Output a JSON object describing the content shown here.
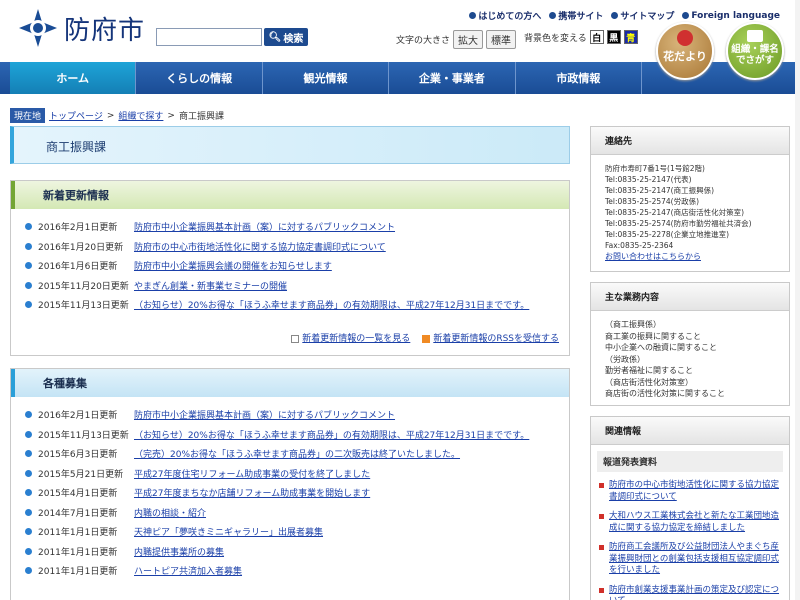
{
  "header": {
    "logo_text": "防府市",
    "search_button": "検索",
    "top_links": [
      "はじめての方へ",
      "携帯サイト",
      "サイトマップ",
      "Foreign language"
    ],
    "font_size_label": "文字の大きさ",
    "font_size_options": [
      "拡大",
      "標準"
    ],
    "bg_color_label": "背景色を変える",
    "bg_color_options": [
      "白",
      "黒",
      "青"
    ],
    "flower_label": "花だより",
    "org_label_1": "組織・課名",
    "org_label_2": "でさがす"
  },
  "nav": [
    "ホーム",
    "くらしの情報",
    "観光情報",
    "企業・事業者",
    "市政情報"
  ],
  "breadcrumb": {
    "label": "現在地",
    "items": [
      "トップページ",
      "組織で探す",
      "商工振興課"
    ]
  },
  "page_title": "商工振興課",
  "news": {
    "heading": "新着更新情報",
    "rows": [
      {
        "date": "2016年2月1日更新",
        "title": "防府市中小企業振興基本計画（案）に対するパブリックコメント"
      },
      {
        "date": "2016年1月20日更新",
        "title": "防府市の中心市街地活性化に関する協力協定書調印式について"
      },
      {
        "date": "2016年1月6日更新",
        "title": "防府市中小企業振興会議の開催をお知らせします"
      },
      {
        "date": "2015年11月20日更新",
        "title": "やまぎん創業・新事業セミナーの開催"
      },
      {
        "date": "2015年11月13日更新",
        "title": "（お知らせ）20%お得な「ほうふ幸せます商品券」の有効期限は、平成27年12月31日までです。"
      }
    ],
    "list_link": "新着更新情報の一覧を見る",
    "rss_link": "新着更新情報のRSSを受信する"
  },
  "boshu": {
    "heading": "各種募集",
    "rows": [
      {
        "date": "2016年2月1日更新",
        "title": "防府市中小企業振興基本計画（案）に対するパブリックコメント"
      },
      {
        "date": "2015年11月13日更新",
        "title": "（お知らせ）20%お得な「ほうふ幸せます商品券」の有効期限は、平成27年12月31日までです。"
      },
      {
        "date": "2015年6月3日更新",
        "title": "（完売）20%お得な「ほうふ幸せます商品券」の二次販売は終了いたしました。"
      },
      {
        "date": "2015年5月21日更新",
        "title": "平成27年度住宅リフォーム助成事業の受付を終了しました"
      },
      {
        "date": "2015年4月1日更新",
        "title": "平成27年度まちなか店舗リフォーム助成事業を開始します"
      },
      {
        "date": "2014年7月1日更新",
        "title": "内職の相談・紹介"
      },
      {
        "date": "2011年1月1日更新",
        "title": "天神ピア「夢咲きミニギャラリー」出展者募集"
      },
      {
        "date": "2011年1月1日更新",
        "title": "内職提供事業所の募集"
      },
      {
        "date": "2011年1月1日更新",
        "title": "ハートピア共済加入者募集"
      }
    ]
  },
  "contact": {
    "heading": "連絡先",
    "lines": [
      "防府市寿町7番1号(1号館2階)",
      "Tel:0835-25-2147(代表)",
      "Tel:0835-25-2147(商工振興係)",
      "Tel:0835-25-2574(労政係)",
      "Tel:0835-25-2147(商店街活性化対策室)",
      "Tel:0835-25-2574(防府市勤労福祉共済会)",
      "Tel:0835-25-2278(企業立地推進室)",
      "Fax:0835-25-2364"
    ],
    "inquiry_link": "お問い合わせはこちらから"
  },
  "biz": {
    "heading": "主な業務内容",
    "lines": [
      "（商工振興係）",
      "商工業の振興に関すること",
      "中小企業への融資に関すること",
      "（労政係）",
      "勤労者福祉に関すること",
      "（商店街活性化対策室）",
      "商店街の活性化対策に関すること"
    ]
  },
  "related": {
    "heading": "関連情報",
    "subheading": "報道発表資料",
    "items": [
      "防府市の中心市街地活性化に関する協力協定書調印式について",
      "大和ハウス工業株式会社と新たな工業団地造成に関する協力協定を締結しました",
      "防府商工会議所及び公益財団法人やまぐち産業振興財団との創業包括支援相互協定調印式を行いました",
      "防府市創業支援事業計画の策定及び認定について"
    ]
  }
}
